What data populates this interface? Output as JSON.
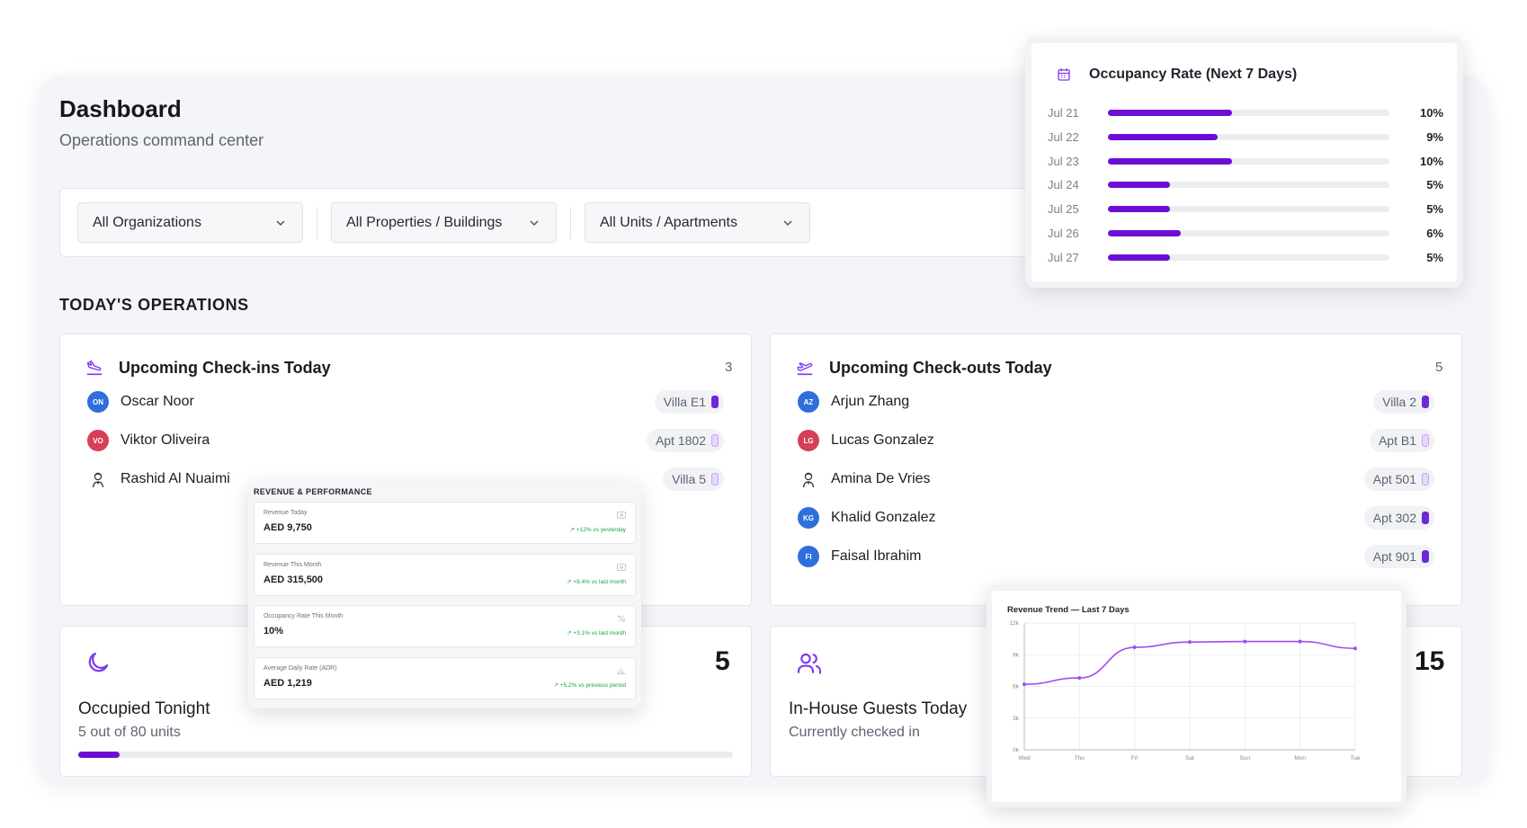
{
  "header": {
    "title": "Dashboard",
    "subtitle": "Operations command center"
  },
  "filters": [
    {
      "label": "All Organizations"
    },
    {
      "label": "All Properties / Buildings"
    },
    {
      "label": "All Units / Apartments"
    }
  ],
  "section_title": "TODAY'S OPERATIONS",
  "checkins": {
    "title": "Upcoming Check-ins Today",
    "count": "3",
    "guests": [
      {
        "initials": "ON",
        "name": "Oscar Noor",
        "unit": "Villa E1",
        "avatar_color": "#2f6fdb",
        "key": "solid"
      },
      {
        "initials": "VO",
        "name": "Viktor Oliveira",
        "unit": "Apt 1802",
        "avatar_color": "#d64056",
        "key": "light"
      },
      {
        "initials": "",
        "name": "Rashid Al Nuaimi",
        "unit": "Villa 5",
        "avatar_color": "",
        "key": "light"
      }
    ]
  },
  "checkouts": {
    "title": "Upcoming Check-outs Today",
    "count": "5",
    "guests": [
      {
        "initials": "AZ",
        "name": "Arjun Zhang",
        "unit": "Villa 2",
        "avatar_color": "#2f6fdb",
        "key": "solid"
      },
      {
        "initials": "LG",
        "name": "Lucas Gonzalez",
        "unit": "Apt B1",
        "avatar_color": "#d64056",
        "key": "light"
      },
      {
        "initials": "",
        "name": "Amina De Vries",
        "unit": "Apt 501",
        "avatar_color": "",
        "key": "light"
      },
      {
        "initials": "KG",
        "name": "Khalid Gonzalez",
        "unit": "Apt 302",
        "avatar_color": "#2f6fdb",
        "key": "solid"
      },
      {
        "initials": "FI",
        "name": "Faisal Ibrahim",
        "unit": "Apt 901",
        "avatar_color": "#2f6fdb",
        "key": "solid"
      }
    ]
  },
  "occupied": {
    "value": "5",
    "label": "Occupied Tonight",
    "sub": "5 out of 80 units",
    "progress": 0.0625
  },
  "inhouse": {
    "value": "15",
    "label": "In-House Guests Today",
    "sub": "Currently checked in"
  },
  "occupancy_rate": {
    "title": "Occupancy Rate (Next 7 Days)",
    "rows": [
      {
        "date": "Jul 21",
        "pct": "10%",
        "fraction": 0.44
      },
      {
        "date": "Jul 22",
        "pct": "9%",
        "fraction": 0.39
      },
      {
        "date": "Jul 23",
        "pct": "10%",
        "fraction": 0.44
      },
      {
        "date": "Jul 24",
        "pct": "5%",
        "fraction": 0.22
      },
      {
        "date": "Jul 25",
        "pct": "5%",
        "fraction": 0.22
      },
      {
        "date": "Jul 26",
        "pct": "6%",
        "fraction": 0.26
      },
      {
        "date": "Jul 27",
        "pct": "5%",
        "fraction": 0.22
      }
    ]
  },
  "revenue_performance": {
    "title": "REVENUE & PERFORMANCE",
    "items": [
      {
        "label": "Revenue Today",
        "value": "AED 9,750",
        "change": "+12% vs yesterday",
        "icon": "wallet-icon"
      },
      {
        "label": "Revenue This Month",
        "value": "AED 315,500",
        "change": "+8.4% vs last month",
        "icon": "wallet-icon"
      },
      {
        "label": "Occupancy Rate This Month",
        "value": "10%",
        "change": "+3.1% vs last month",
        "icon": "percent-icon"
      },
      {
        "label": "Average Daily Rate (ADR)",
        "value": "AED 1,219",
        "change": "+5.2% vs previous period",
        "icon": "bar-chart-icon"
      }
    ]
  },
  "chart_data": {
    "type": "line",
    "title": "Revenue Trend — Last 7 Days",
    "x": [
      "Wed",
      "Thu",
      "Fri",
      "Sat",
      "Sun",
      "Mon",
      "Tue"
    ],
    "series": [
      {
        "values": [
          6200,
          6800,
          9700,
          10200,
          10250,
          10250,
          9600
        ]
      }
    ],
    "yticks": [
      "0k",
      "3k",
      "6k",
      "9k",
      "12k"
    ],
    "ylim": [
      0,
      12000
    ],
    "grid": true,
    "color": "#a24cf0"
  },
  "colors": {
    "accent": "#6d0ed6",
    "positive": "#16a34a"
  }
}
